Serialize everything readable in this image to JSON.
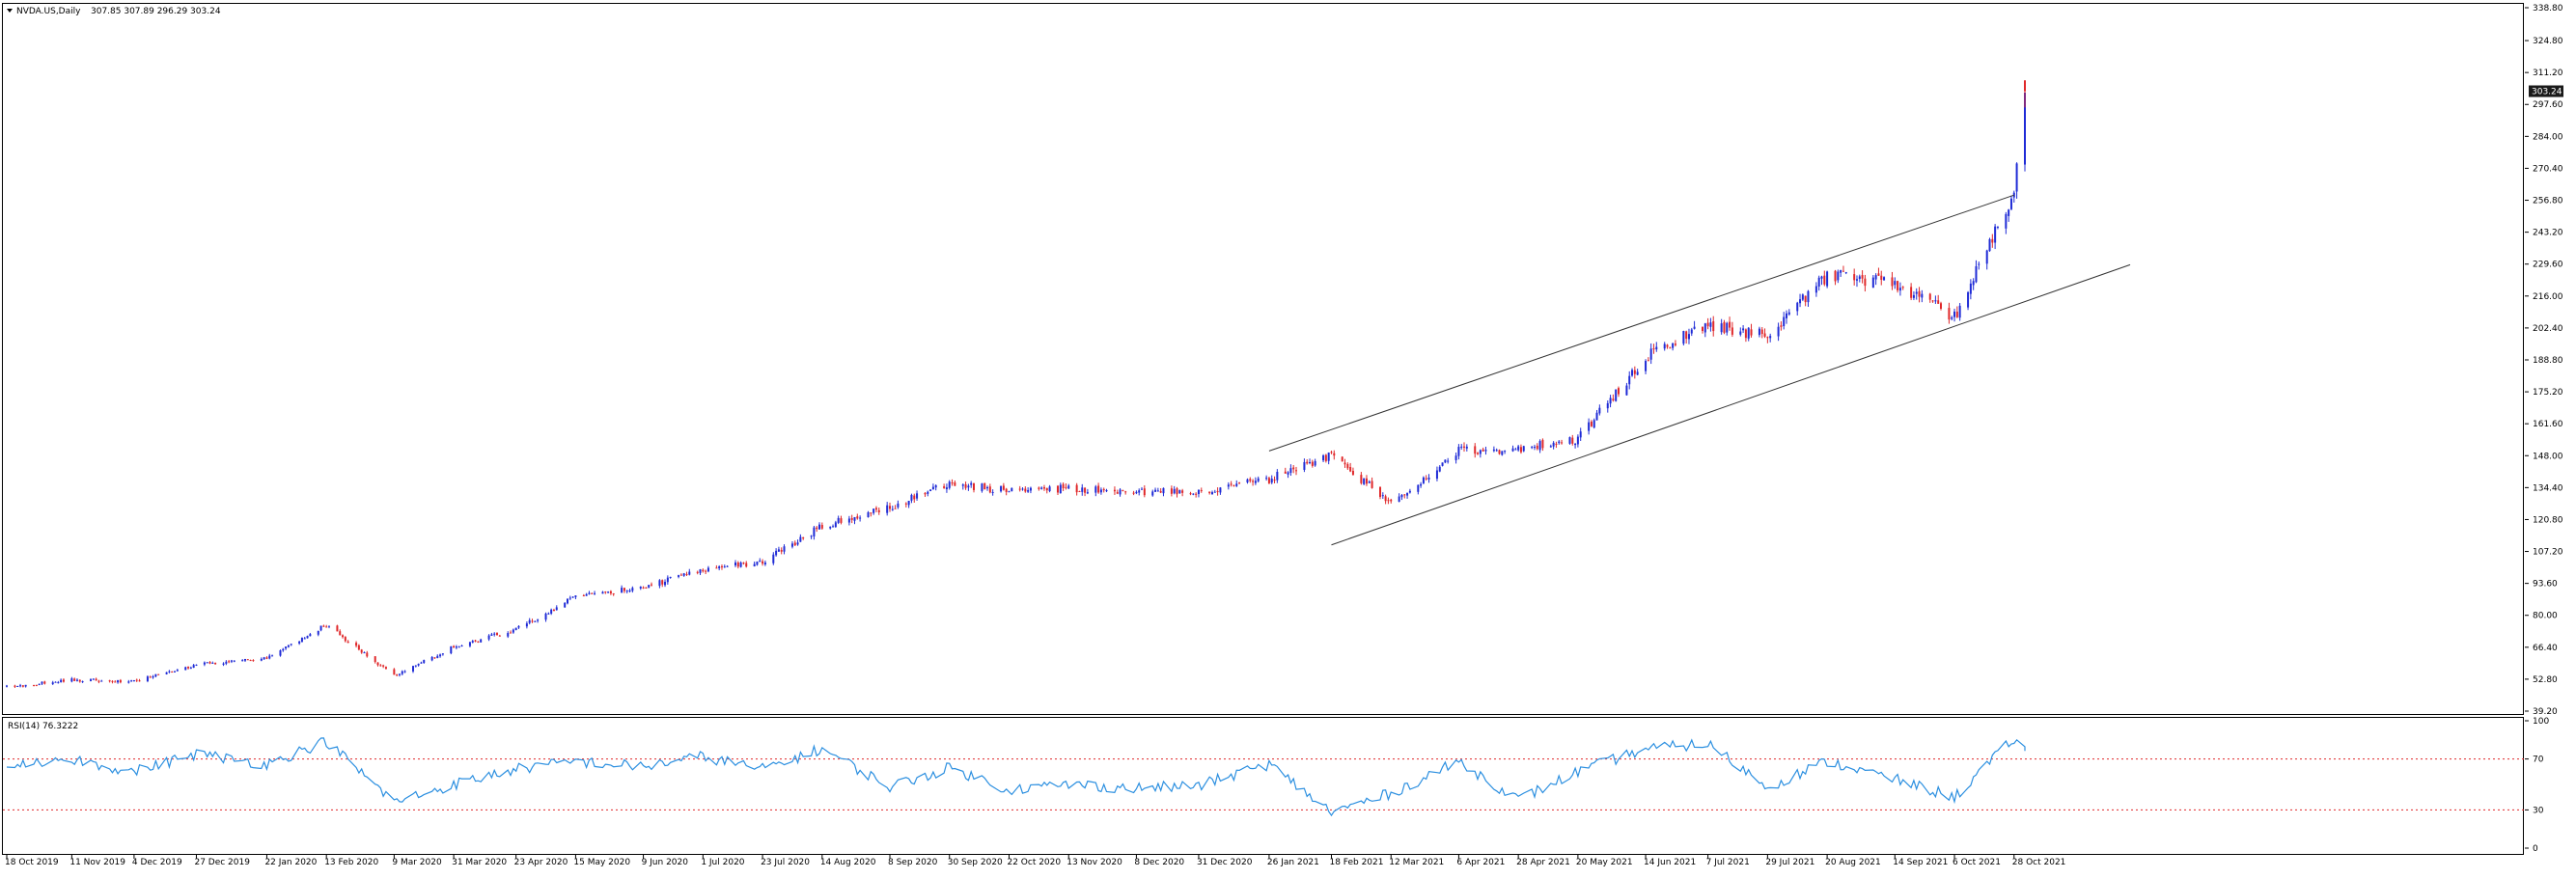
{
  "header": {
    "symbol_label": "NVDA.US,Daily",
    "ohlc_values": "307.85 307.89 296.29 303.24"
  },
  "rsi_header": {
    "label": "RSI(14) 76.3222"
  },
  "colors": {
    "bull": "#1f2bd6",
    "bear": "#e0282a",
    "rsi_line": "#2b8fe0",
    "rsi_level": "#e0282a",
    "channel": "#333333",
    "price_tag_bg": "#1a1a1a",
    "price_tag_fg": "#ffffff"
  },
  "chart_data": [
    {
      "type": "candlestick",
      "symbol": "NVDA.US",
      "timeframe": "Daily",
      "last_price": 303.24,
      "last_price_label": "303.24",
      "ylim": [
        39.2,
        338.8
      ],
      "y_ticks": [
        "338.80",
        "324.80",
        "311.20",
        "297.60",
        "284.00",
        "270.40",
        "256.80",
        "243.20",
        "229.60",
        "216.00",
        "202.40",
        "188.80",
        "175.20",
        "161.60",
        "148.00",
        "134.40",
        "120.80",
        "107.20",
        "93.60",
        "80.00",
        "66.40",
        "52.80",
        "39.20"
      ],
      "x_labels": [
        "18 Oct 2019",
        "11 Nov 2019",
        "4 Dec 2019",
        "27 Dec 2019",
        "22 Jan 2020",
        "13 Feb 2020",
        "9 Mar 2020",
        "31 Mar 2020",
        "23 Apr 2020",
        "15 May 2020",
        "9 Jun 2020",
        "1 Jul 2020",
        "23 Jul 2020",
        "14 Aug 2020",
        "8 Sep 2020",
        "30 Sep 2020",
        "22 Oct 2020",
        "13 Nov 2020",
        "8 Dec 2020",
        "31 Dec 2020",
        "26 Jan 2021",
        "18 Feb 2021",
        "12 Mar 2021",
        "6 Apr 2021",
        "28 Apr 2021",
        "20 May 2021",
        "14 Jun 2021",
        "7 Jul 2021",
        "29 Jul 2021",
        "20 Aug 2021",
        "14 Sep 2021",
        "6 Oct 2021",
        "28 Oct 2021"
      ],
      "close_path": [
        [
          "18 Oct 2019",
          49.5
        ],
        [
          "11 Nov 2019",
          52.5
        ],
        [
          "4 Dec 2019",
          52.0
        ],
        [
          "27 Dec 2019",
          59.0
        ],
        [
          "22 Jan 2020",
          62.0
        ],
        [
          "13 Feb 2020",
          76.0
        ],
        [
          "9 Mar 2020",
          54.0
        ],
        [
          "31 Mar 2020",
          66.5
        ],
        [
          "23 Apr 2020",
          74.0
        ],
        [
          "15 May 2020",
          88.0
        ],
        [
          "9 Jun 2020",
          92.0
        ],
        [
          "1 Jul 2020",
          99.0
        ],
        [
          "23 Jul 2020",
          103.0
        ],
        [
          "14 Aug 2020",
          118.0
        ],
        [
          "8 Sep 2020",
          126.0
        ],
        [
          "30 Sep 2020",
          136.0
        ],
        [
          "22 Oct 2020",
          133.0
        ],
        [
          "13 Nov 2020",
          134.0
        ],
        [
          "8 Dec 2020",
          133.0
        ],
        [
          "31 Dec 2020",
          132.5
        ],
        [
          "26 Jan 2021",
          138.0
        ],
        [
          "18 Feb 2021",
          148.0
        ],
        [
          "12 Mar 2021",
          128.0
        ],
        [
          "6 Apr 2021",
          150.0
        ],
        [
          "28 Apr 2021",
          151.0
        ],
        [
          "20 May 2021",
          155.0
        ],
        [
          "14 Jun 2021",
          190.0
        ],
        [
          "7 Jul 2021",
          204.0
        ],
        [
          "29 Jul 2021",
          199.0
        ],
        [
          "20 Aug 2021",
          225.0
        ],
        [
          "14 Sep 2021",
          222.0
        ],
        [
          "6 Oct 2021",
          207.0
        ],
        [
          "28 Oct 2021",
          260.0
        ],
        [
          "1 Nov 2021",
          303.24
        ]
      ],
      "trend_channel": {
        "upper": [
          [
            "26 Jan 2021",
            150.0
          ],
          [
            "28 Oct 2021",
            259.0
          ]
        ],
        "lower": [
          [
            "18 Feb 2021",
            110.0
          ],
          [
            "28 Oct 2021",
            212.0
          ]
        ]
      }
    },
    {
      "type": "line",
      "name": "RSI(14)",
      "value": 76.3222,
      "ylim": [
        0,
        100
      ],
      "y_ticks": [
        "100",
        "70",
        "30",
        "0"
      ],
      "levels": [
        70,
        30
      ],
      "path": [
        [
          "18 Oct 2019",
          66
        ],
        [
          "11 Nov 2019",
          70
        ],
        [
          "4 Dec 2019",
          60
        ],
        [
          "27 Dec 2019",
          74
        ],
        [
          "22 Jan 2020",
          66
        ],
        [
          "13 Feb 2020",
          84
        ],
        [
          "9 Mar 2020",
          36
        ],
        [
          "31 Mar 2020",
          50
        ],
        [
          "23 Apr 2020",
          62
        ],
        [
          "15 May 2020",
          68
        ],
        [
          "9 Jun 2020",
          64
        ],
        [
          "1 Jul 2020",
          72
        ],
        [
          "23 Jul 2020",
          62
        ],
        [
          "14 Aug 2020",
          78
        ],
        [
          "8 Sep 2020",
          48
        ],
        [
          "30 Sep 2020",
          63
        ],
        [
          "22 Oct 2020",
          46
        ],
        [
          "13 Nov 2020",
          50
        ],
        [
          "8 Dec 2020",
          47
        ],
        [
          "31 Dec 2020",
          49
        ],
        [
          "26 Jan 2021",
          66
        ],
        [
          "18 Feb 2021",
          28
        ],
        [
          "12 Mar 2021",
          43
        ],
        [
          "6 Apr 2021",
          68
        ],
        [
          "28 Apr 2021",
          38
        ],
        [
          "20 May 2021",
          60
        ],
        [
          "14 Jun 2021",
          78
        ],
        [
          "7 Jul 2021",
          82
        ],
        [
          "29 Jul 2021",
          48
        ],
        [
          "20 Aug 2021",
          68
        ],
        [
          "14 Sep 2021",
          54
        ],
        [
          "6 Oct 2021",
          40
        ],
        [
          "28 Oct 2021",
          86
        ],
        [
          "1 Nov 2021",
          76.3
        ]
      ]
    }
  ]
}
